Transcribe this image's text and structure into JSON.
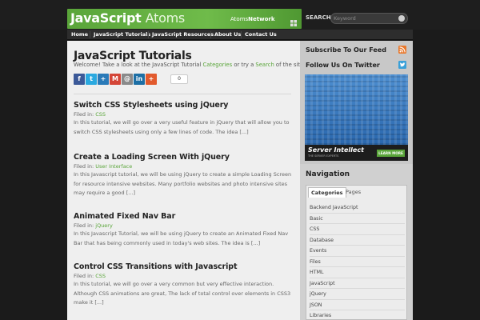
{
  "header": {
    "logo_bold": "JavaScript",
    "logo_thin": "Atoms",
    "network_prefix": "Atoms",
    "network_bold": "Network",
    "search_label": "SEARCH",
    "search_placeholder": "Keyword"
  },
  "nav": [
    "Home",
    "JavaScript Tutorials",
    "JavaScript Resources",
    "About Us",
    "Contact Us"
  ],
  "main": {
    "title": "JavaScript Tutorials",
    "welcome_pre": "Welcome! Take a look at the JavaScript Tutorial ",
    "welcome_link1": "Categories",
    "welcome_mid": " or try a ",
    "welcome_link2": "Search",
    "welcome_post": " of the site!",
    "share_count": "0",
    "share_icons": [
      {
        "name": "facebook",
        "glyph": "f",
        "color": "#3b5998"
      },
      {
        "name": "twitter",
        "glyph": "t",
        "color": "#2aa9e0"
      },
      {
        "name": "share",
        "glyph": "+",
        "color": "#2a7ab8"
      },
      {
        "name": "gmail",
        "glyph": "M",
        "color": "#d44638"
      },
      {
        "name": "email",
        "glyph": "@",
        "color": "#8a8a8a"
      },
      {
        "name": "linkedin",
        "glyph": "in",
        "color": "#1d6fa5"
      },
      {
        "name": "more",
        "glyph": "+",
        "color": "#e25a2d"
      }
    ],
    "filed_label": "Filed in:",
    "posts": [
      {
        "title": "Switch CSS Stylesheets using jQuery",
        "category": "CSS",
        "excerpt": "In this tutorial, we will go over a very useful feature in jQuery that will allow you to switch CSS stylesheets using only a few lines of code. The idea [...]"
      },
      {
        "title": "Create a Loading Screen With jQuery",
        "category": "User Interface",
        "excerpt": "In this Javascript tutorial, we will be using jQuery to create a simple Loading Screen for resource intensive websites. Many portfolio websites and photo intensive sites may require a good [...]"
      },
      {
        "title": "Animated Fixed Nav Bar",
        "category": "jQuery",
        "excerpt": "In this Javascript Tutorial, we will be using jQuery to create an Animated Fixed Nav Bar that has being commonly used in today's web sites. The idea is [...]"
      },
      {
        "title": "Control CSS Transitions with Javascript",
        "category": "CSS",
        "excerpt": "In this tutorial, we will go over a very common but very effective interaction. Although CSS animations are great, The lack of total control over elements in CSS3 make it [...]"
      }
    ]
  },
  "sidebar": {
    "feed_title": "Subscribe To Our Feed",
    "twitter_title": "Follow Us On Twitter",
    "ad_brand": "Server Intellect",
    "ad_tagline": "THE SERVER EXPERTS",
    "ad_button": "LEARN MORE",
    "navigation_title": "Navigation",
    "tabs": [
      "Categories",
      "Pages"
    ],
    "categories": [
      "Backend JavaScript",
      "Basic",
      "CSS",
      "Database",
      "Events",
      "Files",
      "HTML",
      "JavaScript",
      "jQuery",
      "JSON",
      "Libraries"
    ],
    "colors": {
      "accent": "#5aa53a",
      "rss": "#e8782c",
      "twitter": "#3aa0d8"
    }
  }
}
